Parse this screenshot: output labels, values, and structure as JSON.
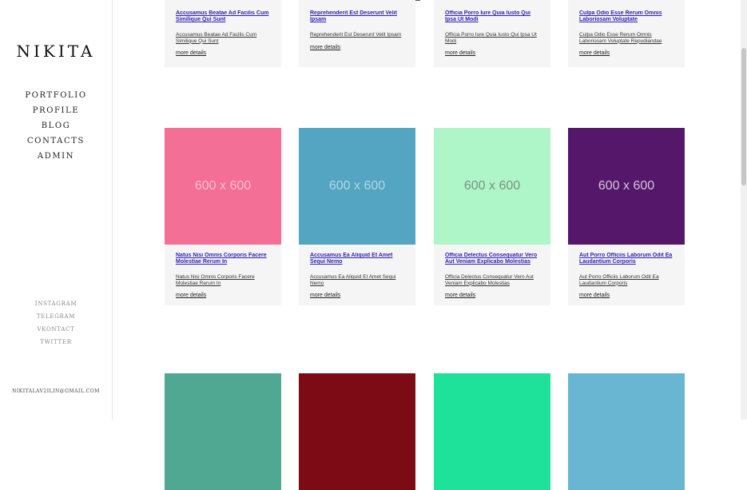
{
  "sidebar": {
    "logo": "NIKITA",
    "nav": [
      "PORTFOLIO",
      "PROFILE",
      "BLOG",
      "CONTACTS",
      "ADMIN"
    ],
    "social": [
      "INSTAGRAM",
      "TELEGRAM",
      "VKONTACT",
      "TWITTER"
    ],
    "email": "NIKITALAV2ILIN@GMAIL.COM"
  },
  "cards_top": [
    {
      "title": "Accusamus Beatae Ad Facilis Cum Similique Qui Sunt",
      "excerpt": "Accusamus Beatae Ad Facilis Cum Similique Qui Sunt",
      "more": "more details"
    },
    {
      "title": "Reprehenderit Est Deserunt Velit Ipsam",
      "excerpt": "Reprehenderit Est Deserunt Velit Ipsam",
      "more": "more details"
    },
    {
      "title": "Officia Porro Iure Quia Iusto Qui Ipsa Ut Modi",
      "excerpt": "Officia Porro Iure Quia Iusto Qui Ipsa Ut Modi",
      "more": "more details"
    },
    {
      "title": "Culpa Odio Esse Rerum Omnis Laboriosam Voluptate Repudiandae",
      "excerpt": "Culpa Odio Esse Rerum Omnis Laboriosam Voluptate Repudiandae",
      "more": "more details"
    }
  ],
  "cards_middle": [
    {
      "placeholder": "600 x 600",
      "color": "#f36f96",
      "title": "Natus Nisi Omnis Corporis Facere Molestiae Rerum In",
      "excerpt": "Natus Nisi Omnis Corporis Facere Molestiae Rerum In",
      "more": "more details"
    },
    {
      "placeholder": "600 x 600",
      "color": "#54a5c2",
      "title": "Accusamus Ea Aliquid Et Amet Sequi Nemo",
      "excerpt": "Accusamus Ea Aliquid Et Amet Sequi Nemo",
      "more": "more details"
    },
    {
      "placeholder": "600 x 600",
      "color": "#aef6c8",
      "title": "Officia Delectus Consequatur Vero Aut Veniam Explicabo Molestias",
      "excerpt": "Officia Delectus Consequatur Vero Aut Veniam Explicabo Molestias",
      "more": "more details"
    },
    {
      "placeholder": "600 x 600",
      "color": "#55176a",
      "title": "Aut Porro Officiis Laborum Odit Ea Laudantium Corporis",
      "excerpt": "Aut Porro Officiis Laborum Odit Ea Laudantium Corporis",
      "more": "more details"
    }
  ],
  "cards_bottom": [
    {
      "color": "#50a892"
    },
    {
      "color": "#7d0b16"
    },
    {
      "color": "#1ee29a"
    },
    {
      "color": "#68b6d2"
    }
  ]
}
